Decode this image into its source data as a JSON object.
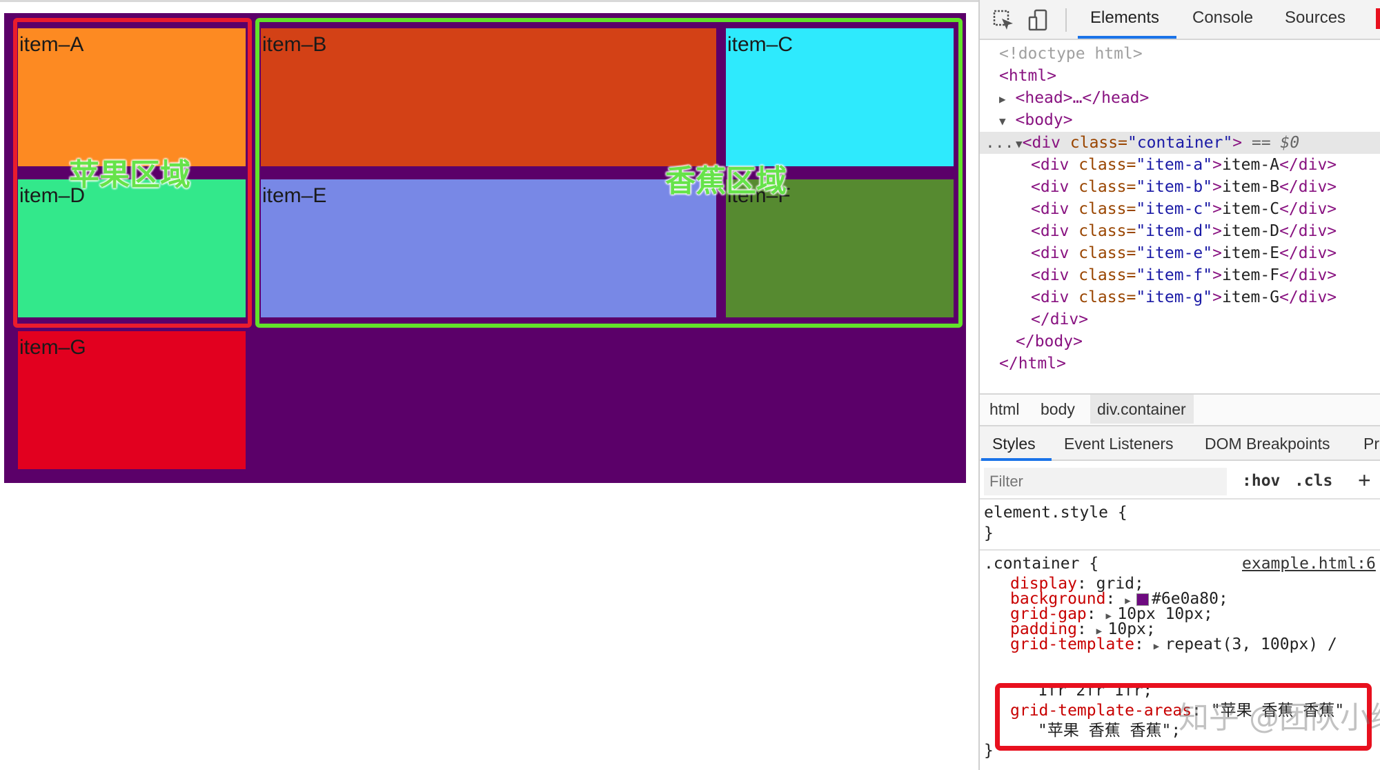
{
  "grid": {
    "items": [
      {
        "label": "item–A",
        "color": "#fd8a22"
      },
      {
        "label": "item–B",
        "color": "#d34116"
      },
      {
        "label": "item–C",
        "color": "#2eeafd"
      },
      {
        "label": "item–D",
        "color": "#33e88b"
      },
      {
        "label": "item–E",
        "color": "#7888e6"
      },
      {
        "label": "item–F",
        "color": "#568a30"
      },
      {
        "label": "item–G",
        "color": "#e2001f"
      }
    ],
    "container_color": "#5b0069",
    "regions": {
      "apple": {
        "label": "苹果区域",
        "color": "#ea1c2d"
      },
      "banana": {
        "label": "香蕉区域",
        "color": "#62e22a"
      }
    }
  },
  "devtools": {
    "tabs": [
      "Elements",
      "Console",
      "Sources"
    ],
    "active_tab": "Elements",
    "icons": [
      "inspect-cursor-icon",
      "device-toggle-icon"
    ],
    "dom": {
      "doctype": "<!doctype html>",
      "html_open": "<html>",
      "head": "<head>…</head>",
      "body_open": "<body>",
      "ellipsis": "...",
      "container_open_tag": "<div",
      "container_attr": " class=",
      "container_value": "\"container\"",
      "container_close": ">",
      "container_selected": " == $0",
      "children": [
        {
          "cls": "\"item-a\"",
          "text": "item-A"
        },
        {
          "cls": "\"item-b\"",
          "text": "item-B"
        },
        {
          "cls": "\"item-c\"",
          "text": "item-C"
        },
        {
          "cls": "\"item-d\"",
          "text": "item-D"
        },
        {
          "cls": "\"item-e\"",
          "text": "item-E"
        },
        {
          "cls": "\"item-f\"",
          "text": "item-F"
        },
        {
          "cls": "\"item-g\"",
          "text": "item-G"
        }
      ],
      "div_close": "</div>",
      "body_close": "</body>",
      "html_close": "</html>"
    },
    "breadcrumbs": [
      "html",
      "body",
      "div.container"
    ],
    "subtabs": [
      "Styles",
      "Event Listeners",
      "DOM Breakpoints",
      "Pr"
    ],
    "active_subtab": "Styles",
    "filter_placeholder": "Filter",
    "hov": ":hov",
    "cls": ".cls",
    "add": "+",
    "element_style": "element.style {",
    "close_brace": "}",
    "rule": {
      "selector": ".container {",
      "source": "example.html:6",
      "decls": [
        {
          "prop": "display",
          "value": "grid;"
        },
        {
          "prop": "background",
          "value": "#6e0a80;",
          "swatch": "#6e0a80"
        },
        {
          "prop": "grid-gap",
          "value": "10px 10px;"
        },
        {
          "prop": "padding",
          "value": "10px;"
        },
        {
          "prop": "grid-template",
          "value": "repeat(3, 100px) /"
        }
      ],
      "continuation": "1fr 2fr 1fr;",
      "areas_prop": "grid-template-areas",
      "areas_value1": "\"苹果 香蕉 香蕉\"",
      "areas_value2": "\"苹果 香蕉 香蕉\";",
      "highlight_color": "#e8101e"
    },
    "watermark": "知乎 @团队小编"
  }
}
